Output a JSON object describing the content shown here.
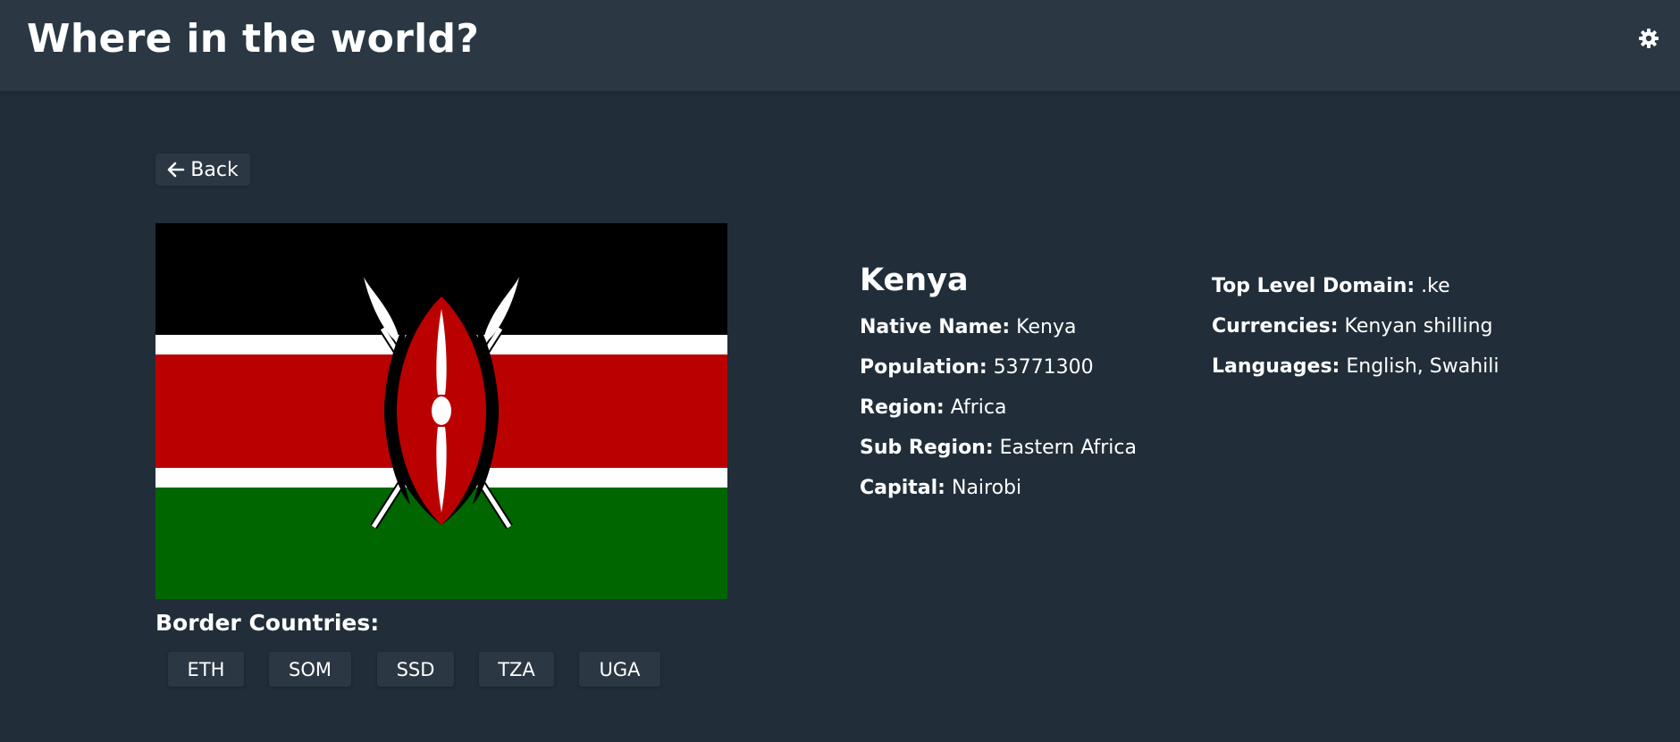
{
  "header": {
    "title": "Where in the world?",
    "theme_icon": "gear-icon"
  },
  "back_button": {
    "label": "Back",
    "icon": "arrow-left-icon"
  },
  "country": {
    "name": "Kenya",
    "flag_icon": "kenya-flag",
    "details_left": [
      {
        "label": "Native Name:",
        "value": "Kenya"
      },
      {
        "label": "Population:",
        "value": "53771300"
      },
      {
        "label": "Region:",
        "value": "Africa"
      },
      {
        "label": "Sub Region:",
        "value": "Eastern Africa"
      },
      {
        "label": "Capital:",
        "value": "Nairobi"
      }
    ],
    "details_right": [
      {
        "label": "Top Level Domain:",
        "value": ".ke"
      },
      {
        "label": "Currencies:",
        "value": "Kenyan shilling"
      },
      {
        "label": "Languages:",
        "value": "English, Swahili"
      }
    ]
  },
  "borders": {
    "title": "Border Countries:",
    "items": [
      "ETH",
      "SOM",
      "SSD",
      "TZA",
      "UGA"
    ]
  },
  "colors": {
    "background": "#212e39",
    "surface": "#2b3844",
    "text": "#ffffff"
  }
}
